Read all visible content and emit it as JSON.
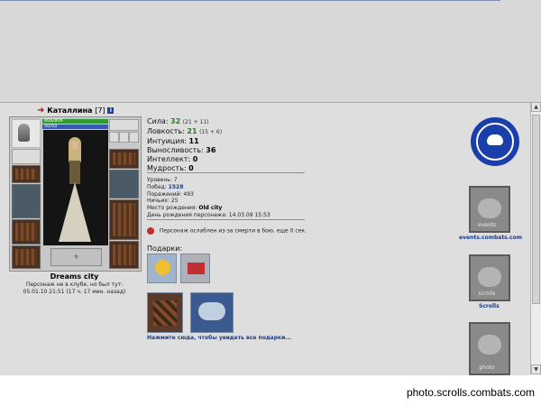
{
  "character": {
    "name": "Каталлина",
    "level": "[7]",
    "hp": "806/806",
    "mp": "50/50",
    "emblem_text": "Dreams city",
    "club_name": "Dreams city",
    "club_note_line1": "Персонаж не в клубе, но был тут:",
    "club_note_line2": "05.01.10 21:51 (17 ч. 17 мин. назад)"
  },
  "stats": [
    {
      "label": "Сила:",
      "value": "32",
      "extra": "(21 + 11)",
      "highlight": true
    },
    {
      "label": "Ловкость:",
      "value": "21",
      "extra": "(15 + 6)",
      "highlight": true
    },
    {
      "label": "Интуиция:",
      "value": "11",
      "extra": "",
      "highlight": false
    },
    {
      "label": "Выносливость:",
      "value": "36",
      "extra": "",
      "highlight": false
    },
    {
      "label": "Интеллект:",
      "value": "0",
      "extra": "",
      "highlight": false
    },
    {
      "label": "Мудрость:",
      "value": "0",
      "extra": "",
      "highlight": false
    }
  ],
  "info": {
    "level": "Уровень: 7",
    "wins_label": "Побед:",
    "wins_value": "1528",
    "losses": "Поражений: 493",
    "draws": "Ничьих: 25",
    "birthplace_label": "Место рождения:",
    "birthplace_value": "Old city",
    "birthday": "День рождения персонажа: 14.03.09 15:53"
  },
  "status": {
    "weakened": "Персонаж ослаблен из-за смерти в бою, еще 0 сек."
  },
  "gifts": {
    "title": "Подарки:",
    "link": "Нажмите сюда, чтобы увидеть все подарки..."
  },
  "sidebar": {
    "events_banner_text": "events",
    "events_label": "events.combats.com",
    "scrolls_banner_text": "scrolls",
    "scrolls_label": "Scrolls",
    "photo_banner_text": "photo"
  },
  "footer": {
    "watermark": "photo.scrolls.combats.com"
  },
  "icons": {
    "arrow": "red-arrow-icon",
    "info": "info-icon",
    "logo": "combats-logo-icon",
    "weak": "weakened-status-icon"
  },
  "colors": {
    "panel_bg": "#dedede",
    "link_blue": "#1a3a8a",
    "stat_green": "#2b7a2b",
    "logo_blue": "#1b3faa"
  }
}
